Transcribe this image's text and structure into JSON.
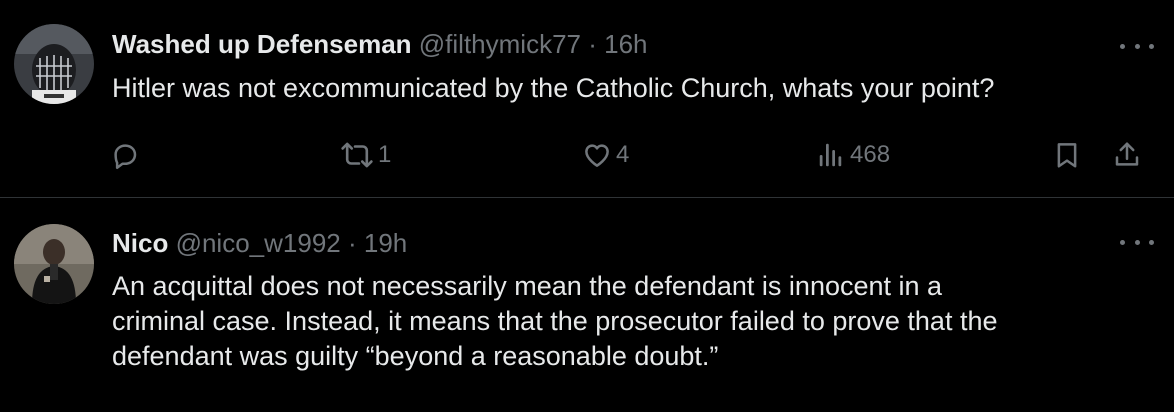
{
  "tweets": [
    {
      "display_name": "Washed up Defenseman",
      "handle": "@filthymick77",
      "separator": "·",
      "time": "16h",
      "text_lines": [
        "Hitler was not excommunicated by the Catholic Church, whats your point?"
      ],
      "actions": {
        "reply_count": "",
        "repost_count": "1",
        "like_count": "4",
        "view_count": "468"
      }
    },
    {
      "display_name": "Nico",
      "handle": "@nico_w1992",
      "separator": "·",
      "time": "19h",
      "text_lines": [
        "An acquittal does not necessarily mean the defendant is innocent in a",
        "criminal case. Instead, it means that the prosecutor failed to prove that the",
        "defendant was guilty “beyond a reasonable doubt.”"
      ]
    }
  ],
  "icons": {
    "reply": "reply-icon",
    "repost": "repost-icon",
    "like": "heart-icon",
    "views": "views-icon",
    "bookmark": "bookmark-icon",
    "share": "share-icon",
    "more": "more-icon"
  },
  "colors": {
    "background": "#000000",
    "text": "#e7e9ea",
    "secondary": "#71767b",
    "divider": "#2f3336"
  }
}
